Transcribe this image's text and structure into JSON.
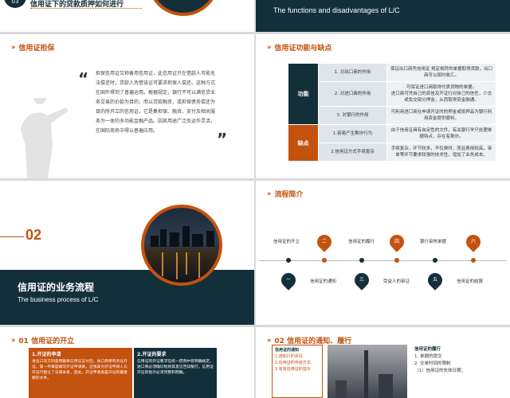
{
  "slide1": {
    "number": "03",
    "title": "信用证下的贷款质押如何进行"
  },
  "slide2": {
    "subtitle_en": "The functions and disadvantages of L/C"
  },
  "slide3": {
    "section": "信用证担保",
    "body": "担保信用证又称备用信用证，此信用证只在借款人可能无法偿还时，贷款人凭借该证可要求担保人偿还。这种方式在国外得到了普遍运用。根据规定，银行不可以满信贷业务交易的价款为目的，而以贷款融资，或担保债务偿还为目的所开立的信用证。它是集担保、融资、支付及相关服务为一体的多功能金融产品。因其用途广泛及运作灵活，在国际商务中得以普遍应用。",
    "quote_open": "“",
    "quote_close": "”"
  },
  "slide4": {
    "section": "信用证功能与缺点",
    "func_label": "功能",
    "bad_label": "缺点",
    "rows": [
      {
        "item": "1. 对出口商的作用",
        "desc": "保证出口商凭信用证 规定相符的单据取得货款，出口商可以按时收汇。"
      },
      {
        "item": "2. 对进口商的作用",
        "desc": "可保证进口商取得代表货物的单据。\n进口商可凭自己的资信及开证行对自己的信任，少交或免交部分押金，从而取得资金融通。"
      },
      {
        "item": "3. 对银行的作用",
        "desc": "可利用进口商在申请开证时的押金或抵押品为银行利用资金提供便利。"
      },
      {
        "item": "1.容易产生欺诈行为",
        "desc": "由于信用证具有自足性的文件，有关银行学只处理单据特点，存在有欺诈。"
      },
      {
        "item": "2.信用证方式手续复杂",
        "desc": "手续复杂，环节较多，不仅费时，而且费用较高，审单等环节要求较强的技术性，增加了业务成本。"
      }
    ]
  },
  "slide5": {
    "number": "02",
    "title": "信用证的业务流程",
    "subtitle_en": "The business process of  L/C"
  },
  "slide6": {
    "section": "流程简介",
    "top_labels": [
      "信用证的开立",
      "信用证的履行",
      "银行审核单据"
    ],
    "bottom_labels": [
      "信用证的通知",
      "受益人的审证",
      "信用证的结算"
    ],
    "top_marks": [
      "二",
      "四",
      "六"
    ],
    "bottom_marks": [
      "一",
      "三",
      "五"
    ]
  },
  "slide7": {
    "section": "01 信用证的开立",
    "box1_title": "1.开证的申请",
    "box1_text": "进出口双方同意用跟单信用证支付后，进口商便有责任开证。第一件事是填写开证申请表，这张表为开证申请人与开证行建立了法律关系，因此，开证申请表是开证的最重要的文件。",
    "box2_title": "2.开证的要求",
    "box2_text": "信用证的开证要求在统一惯例中有明确规定，进口商必须确切地将其意见告知银行。信用证开证的指示必须完整和明确。"
  },
  "slide8": {
    "section": "02 信用证的通知、履行",
    "left_title": "信用证的通知",
    "left_items": [
      "1.通知行的责任",
      "2.信用证的传递方式",
      "3.有效信用证的指示"
    ],
    "right_title": "信用证的履行",
    "right_items": [
      "1. 单据的提交",
      "2. 交单时间的限制",
      "（1）信用证的失效日期；"
    ]
  },
  "colors": {
    "navy": "#13303a",
    "orange": "#c4520f"
  }
}
